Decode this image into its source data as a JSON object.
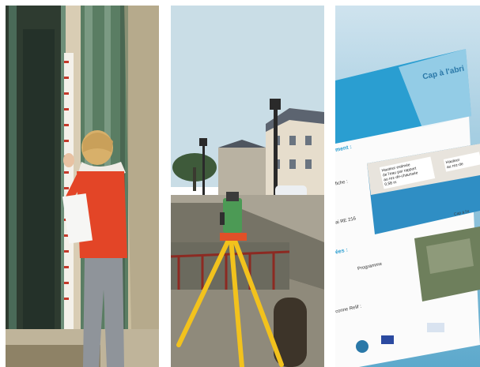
{
  "panels": [
    {
      "scene": "person-measuring-flood-level-on-door"
    },
    {
      "scene": "surveyor-total-station-on-quay"
    },
    {
      "scene": "cap-a-labri-brochure"
    }
  ],
  "brochure": {
    "logo_text": "Cap à l'abri",
    "headings": [
      "ment :",
      "ées :"
    ],
    "lines": [
      "fiche :",
      "ai RE 216",
      "Programme",
      "conne Relif :"
    ],
    "callout_left": "Hauteur estimée\nde l'eau par rapport\nau rez-de-chaussée\n0,58 m",
    "callout_right": "Hauteur\nau rez-de",
    "note_right": "Cap à l'e"
  },
  "colors": {
    "sky": "#c9dde6",
    "tripod": "#f2c21d",
    "brochure_blue": "#2a9ed1",
    "jacket": "#e34527"
  }
}
